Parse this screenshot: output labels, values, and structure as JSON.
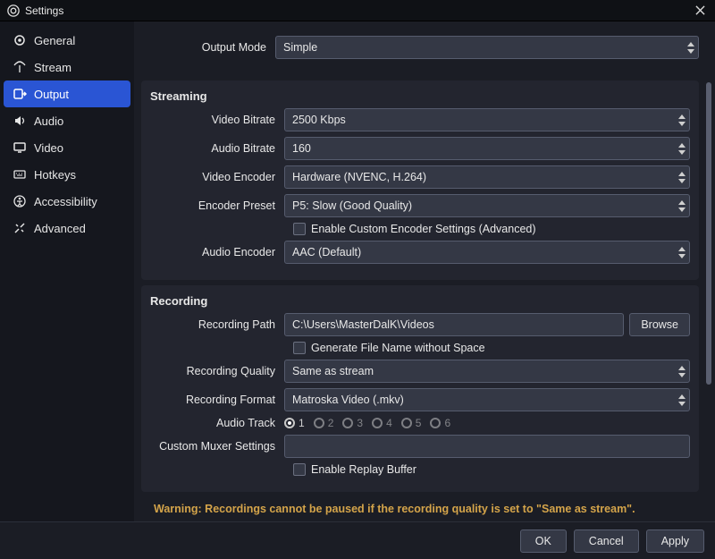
{
  "window": {
    "title": "Settings"
  },
  "sidebar": {
    "items": [
      {
        "label": "General"
      },
      {
        "label": "Stream"
      },
      {
        "label": "Output"
      },
      {
        "label": "Audio"
      },
      {
        "label": "Video"
      },
      {
        "label": "Hotkeys"
      },
      {
        "label": "Accessibility"
      },
      {
        "label": "Advanced"
      }
    ],
    "active_index": 2
  },
  "output_mode": {
    "label": "Output Mode",
    "value": "Simple"
  },
  "streaming": {
    "title": "Streaming",
    "video_bitrate": {
      "label": "Video Bitrate",
      "value": "2500 Kbps"
    },
    "audio_bitrate": {
      "label": "Audio Bitrate",
      "value": "160"
    },
    "video_encoder": {
      "label": "Video Encoder",
      "value": "Hardware (NVENC, H.264)"
    },
    "encoder_preset": {
      "label": "Encoder Preset",
      "value": "P5: Slow (Good Quality)"
    },
    "enable_custom": {
      "label": "Enable Custom Encoder Settings (Advanced)",
      "checked": false
    },
    "audio_encoder": {
      "label": "Audio Encoder",
      "value": "AAC (Default)"
    }
  },
  "recording": {
    "title": "Recording",
    "path": {
      "label": "Recording Path",
      "value": "C:\\Users\\MasterDalK\\Videos",
      "browse": "Browse"
    },
    "gen_filename": {
      "label": "Generate File Name without Space",
      "checked": false
    },
    "quality": {
      "label": "Recording Quality",
      "value": "Same as stream"
    },
    "format": {
      "label": "Recording Format",
      "value": "Matroska Video (.mkv)"
    },
    "audio_track": {
      "label": "Audio Track",
      "tracks": [
        "1",
        "2",
        "3",
        "4",
        "5",
        "6"
      ],
      "selected_index": 0
    },
    "muxer": {
      "label": "Custom Muxer Settings",
      "value": ""
    },
    "replay_buffer": {
      "label": "Enable Replay Buffer",
      "checked": false
    }
  },
  "warning": "Warning: Recordings cannot be paused if the recording quality is set to \"Same as stream\".",
  "footer": {
    "ok": "OK",
    "cancel": "Cancel",
    "apply": "Apply"
  }
}
